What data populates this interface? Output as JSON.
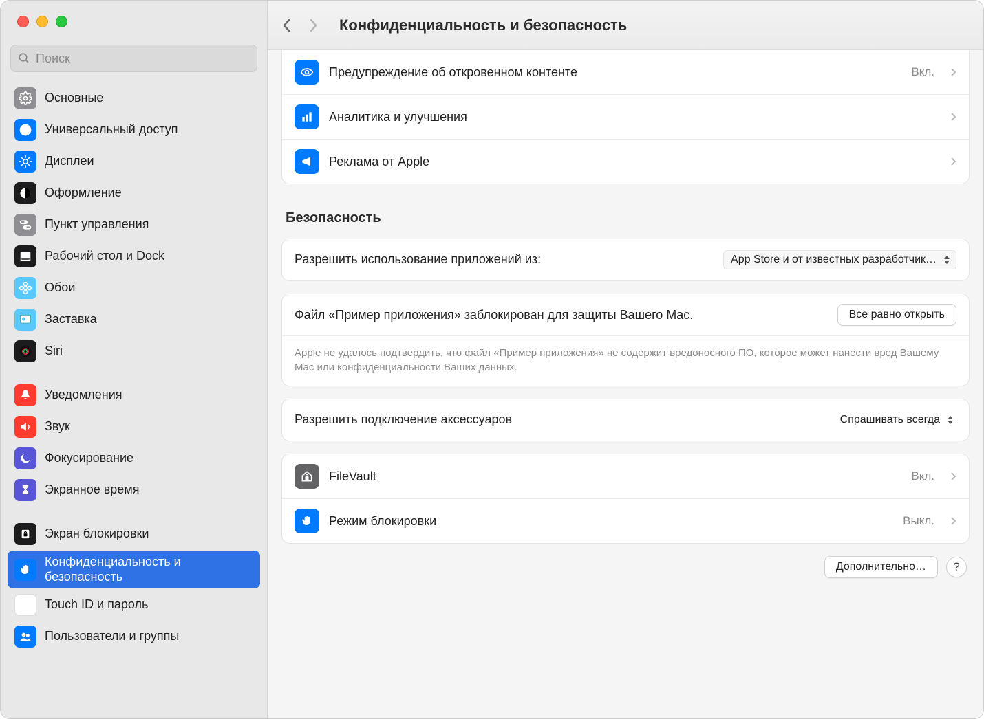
{
  "search": {
    "placeholder": "Поиск"
  },
  "title": "Конфиденциальность и безопасность",
  "sidebar": {
    "groups": [
      [
        {
          "label": "Основные",
          "icon": "gear",
          "bg": "bg-gray"
        },
        {
          "label": "Универсальный доступ",
          "icon": "accessibility",
          "bg": "bg-blue"
        },
        {
          "label": "Дисплеи",
          "icon": "sun",
          "bg": "bg-blue"
        },
        {
          "label": "Оформление",
          "icon": "contrast",
          "bg": "bg-black"
        },
        {
          "label": "Пункт управления",
          "icon": "switches",
          "bg": "bg-gray"
        },
        {
          "label": "Рабочий стол и Dock",
          "icon": "dock",
          "bg": "bg-black"
        },
        {
          "label": "Обои",
          "icon": "flower",
          "bg": "bg-cyan"
        },
        {
          "label": "Заставка",
          "icon": "screensaver",
          "bg": "bg-cyan"
        },
        {
          "label": "Siri",
          "icon": "siri",
          "bg": "bg-black"
        }
      ],
      [
        {
          "label": "Уведомления",
          "icon": "bell",
          "bg": "bg-red"
        },
        {
          "label": "Звук",
          "icon": "speaker",
          "bg": "bg-red"
        },
        {
          "label": "Фокусирование",
          "icon": "moon",
          "bg": "bg-purple"
        },
        {
          "label": "Экранное время",
          "icon": "hourglass",
          "bg": "bg-purple"
        }
      ],
      [
        {
          "label": "Экран блокировки",
          "icon": "lockscreen",
          "bg": "bg-black"
        },
        {
          "label": "Конфиденциальность и безопасность",
          "icon": "hand",
          "bg": "bg-blue",
          "selected": true
        },
        {
          "label": "Touch ID и пароль",
          "icon": "fingerprint",
          "bg": "bg-white"
        },
        {
          "label": "Пользователи и группы",
          "icon": "users",
          "bg": "bg-blue"
        }
      ]
    ]
  },
  "top_rows": [
    {
      "label": "Предупреждение об откровенном контенте",
      "value": "Вкл.",
      "icon": "eye",
      "bg": "bg-blue"
    },
    {
      "label": "Аналитика и улучшения",
      "value": "",
      "icon": "chart",
      "bg": "bg-blue"
    },
    {
      "label": "Реклама от Apple",
      "value": "",
      "icon": "megaphone",
      "bg": "bg-blue"
    }
  ],
  "security": {
    "header": "Безопасность",
    "allow_apps_label": "Разрешить использование приложений из:",
    "allow_apps_value": "App Store и от известных разработчик…",
    "blocked_msg": "Файл «Пример приложения» заблокирован для защиты Вашего Mac.",
    "open_anyway": "Все равно открыть",
    "blocked_note": "Apple не удалось подтвердить, что файл «Пример приложения» не содержит вредоносного ПО, которое может нанести вред Вашему Mac или конфиденциальности Ваших данных.",
    "accessories_label": "Разрешить подключение аксессуаров",
    "accessories_value": "Спрашивать всегда",
    "rows": [
      {
        "label": "FileVault",
        "value": "Вкл.",
        "icon": "house",
        "bg": "bg-dgray"
      },
      {
        "label": "Режим блокировки",
        "value": "Выкл.",
        "icon": "hand",
        "bg": "bg-blue"
      }
    ]
  },
  "advanced_label": "Дополнительно…",
  "help": "?"
}
